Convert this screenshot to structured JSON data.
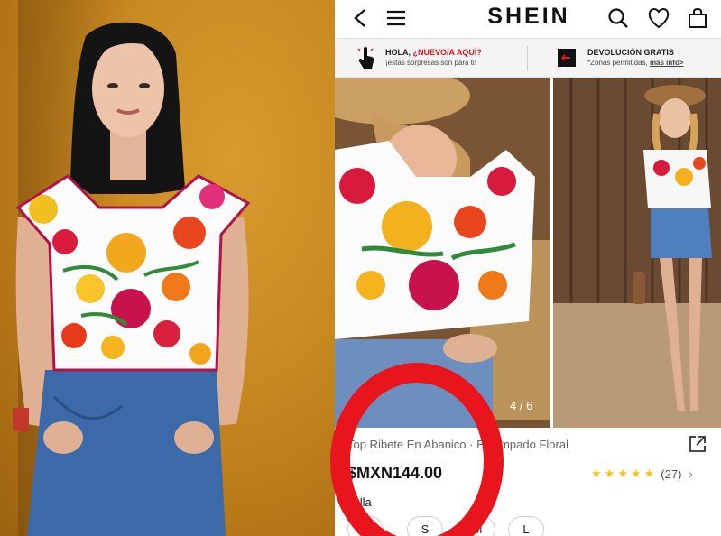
{
  "header": {
    "brand": "SHEIN",
    "icons": [
      "back-chevron-icon",
      "hamburger-menu-icon",
      "search-icon",
      "heart-icon",
      "shopping-bag-icon"
    ]
  },
  "promo": {
    "greeting": {
      "prefix": "HOLA, ",
      "highlight": "¿NUEVO/A AQUÍ?",
      "sub": "¡estas sorpresas son para ti!",
      "icon": "tap-hand-icon"
    },
    "returns": {
      "title": "DEVOLUCIÓN GRATIS",
      "sub": "*Zonas permitidas,",
      "link": "más info>",
      "icon": "return-box-icon"
    }
  },
  "gallery": {
    "counter": "4 / 6"
  },
  "product": {
    "title": "Top Ribete En Abanico · Estampado Floral",
    "price": "$MXN144.00",
    "rating": 5,
    "review_count": "(27)",
    "size_label": "Talla",
    "sizes": [
      "XS",
      "S",
      "M",
      "L"
    ]
  },
  "colors": {
    "highlight_circle": "#e8161c",
    "star": "#f5c518",
    "wall": "#c98a22"
  }
}
